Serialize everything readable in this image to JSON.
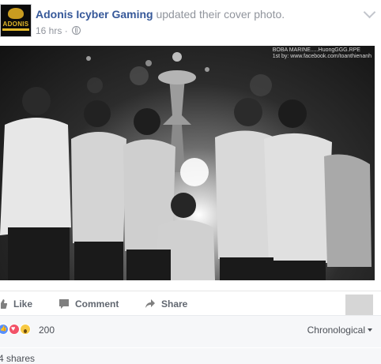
{
  "post": {
    "page_name": "Adonis Icyber Gaming",
    "action": " updated their cover photo.",
    "time": "16 hrs",
    "separator": "·",
    "avatar_text": "ADONIS",
    "avatar_icon": "page-logo-icon",
    "privacy_icon": "globe-icon",
    "menu_icon": "chevron-down-icon"
  },
  "photo": {
    "watermark_line1": "BOBA MARINE.....HuongGGG.RPE",
    "watermark_line2": "1st by: www.facebook.com/toanthienanh"
  },
  "actions": {
    "like": "Like",
    "comment": "Comment",
    "share": "Share"
  },
  "reactions": {
    "types": [
      "like",
      "love",
      "wow"
    ],
    "count": "200",
    "sort": "Chronological"
  },
  "shares": {
    "text": "4 shares"
  },
  "colors": {
    "link": "#365899",
    "muted": "#90949c",
    "like": "#5890ff",
    "love": "#f25268",
    "wow": "#f7c944"
  }
}
